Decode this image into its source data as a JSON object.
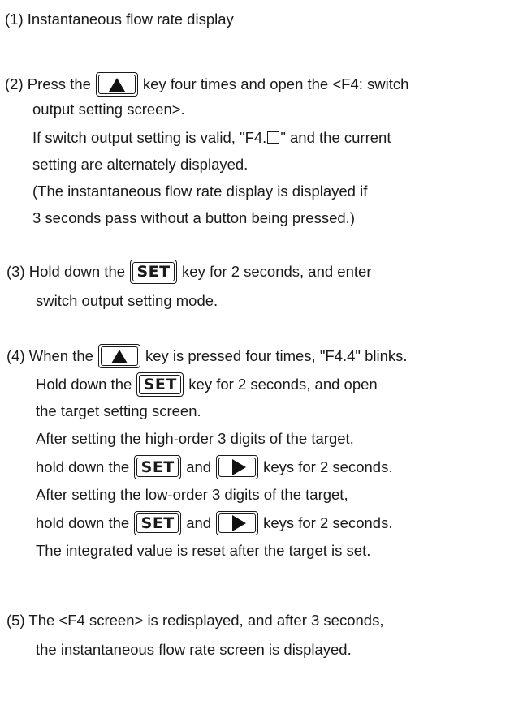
{
  "steps": [
    {
      "lines": [
        {
          "a": "(1) Instantaneous flow rate display"
        }
      ]
    },
    {
      "lines": [
        {
          "a": "(2) Press the",
          "b": "key four times and open the <F4: switch"
        },
        {
          "a": "output setting screen>."
        },
        {
          "a": "If switch output setting is valid, \"F4.",
          "b": "\" and the current"
        },
        {
          "a": "setting are alternately displayed."
        },
        {
          "a": "(The instantaneous flow rate display is displayed if"
        },
        {
          "a": "3 seconds pass without a button being pressed.)"
        }
      ]
    },
    {
      "lines": [
        {
          "a": "(3) Hold down the",
          "b": "key for 2 seconds, and enter"
        },
        {
          "a": "switch output setting mode."
        }
      ]
    },
    {
      "lines": [
        {
          "a": "(4) When the",
          "b": "key is pressed four times, \"F4.4\" blinks."
        },
        {
          "a": "Hold down the",
          "b": "key for 2 seconds, and open"
        },
        {
          "a": "the target setting screen."
        },
        {
          "a": "After setting the high-order 3 digits of the target,"
        },
        {
          "a": "hold down the",
          "b": "and",
          "c": "keys for 2 seconds."
        },
        {
          "a": "After setting the low-order 3 digits of the target,"
        },
        {
          "a": "hold down the",
          "b": "and",
          "c": "keys for 2 seconds."
        },
        {
          "a": "The integrated value is reset after the target is set."
        }
      ]
    },
    {
      "lines": [
        {
          "a": "(5) The <F4 screen> is redisplayed, and after 3 seconds,"
        },
        {
          "a": "the instantaneous flow rate screen is displayed."
        }
      ]
    }
  ],
  "keys": {
    "set_label": "SET",
    "up_icon": "up-triangle-icon",
    "right_icon": "right-triangle-icon"
  }
}
